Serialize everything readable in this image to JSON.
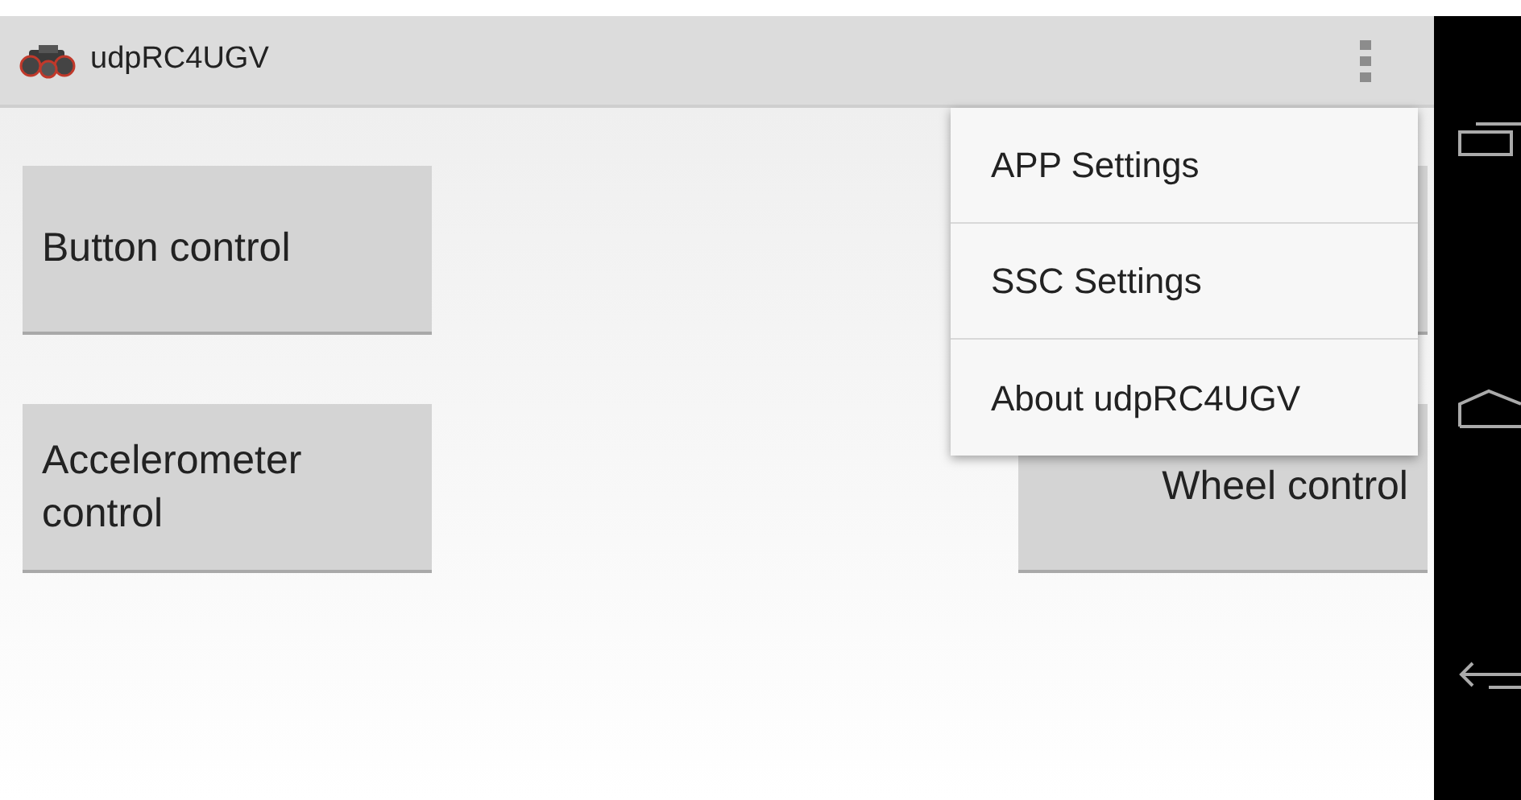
{
  "app_bar": {
    "title": "udpRC4UGV"
  },
  "buttons": [
    {
      "label": "Button control"
    },
    {
      "label": "Accelerometer control"
    },
    {
      "covered": true
    },
    {
      "label": "Wheel control"
    }
  ],
  "menu": {
    "items": [
      {
        "label": "APP Settings"
      },
      {
        "label": "SSC Settings"
      },
      {
        "label": "About udpRC4UGV"
      }
    ]
  }
}
